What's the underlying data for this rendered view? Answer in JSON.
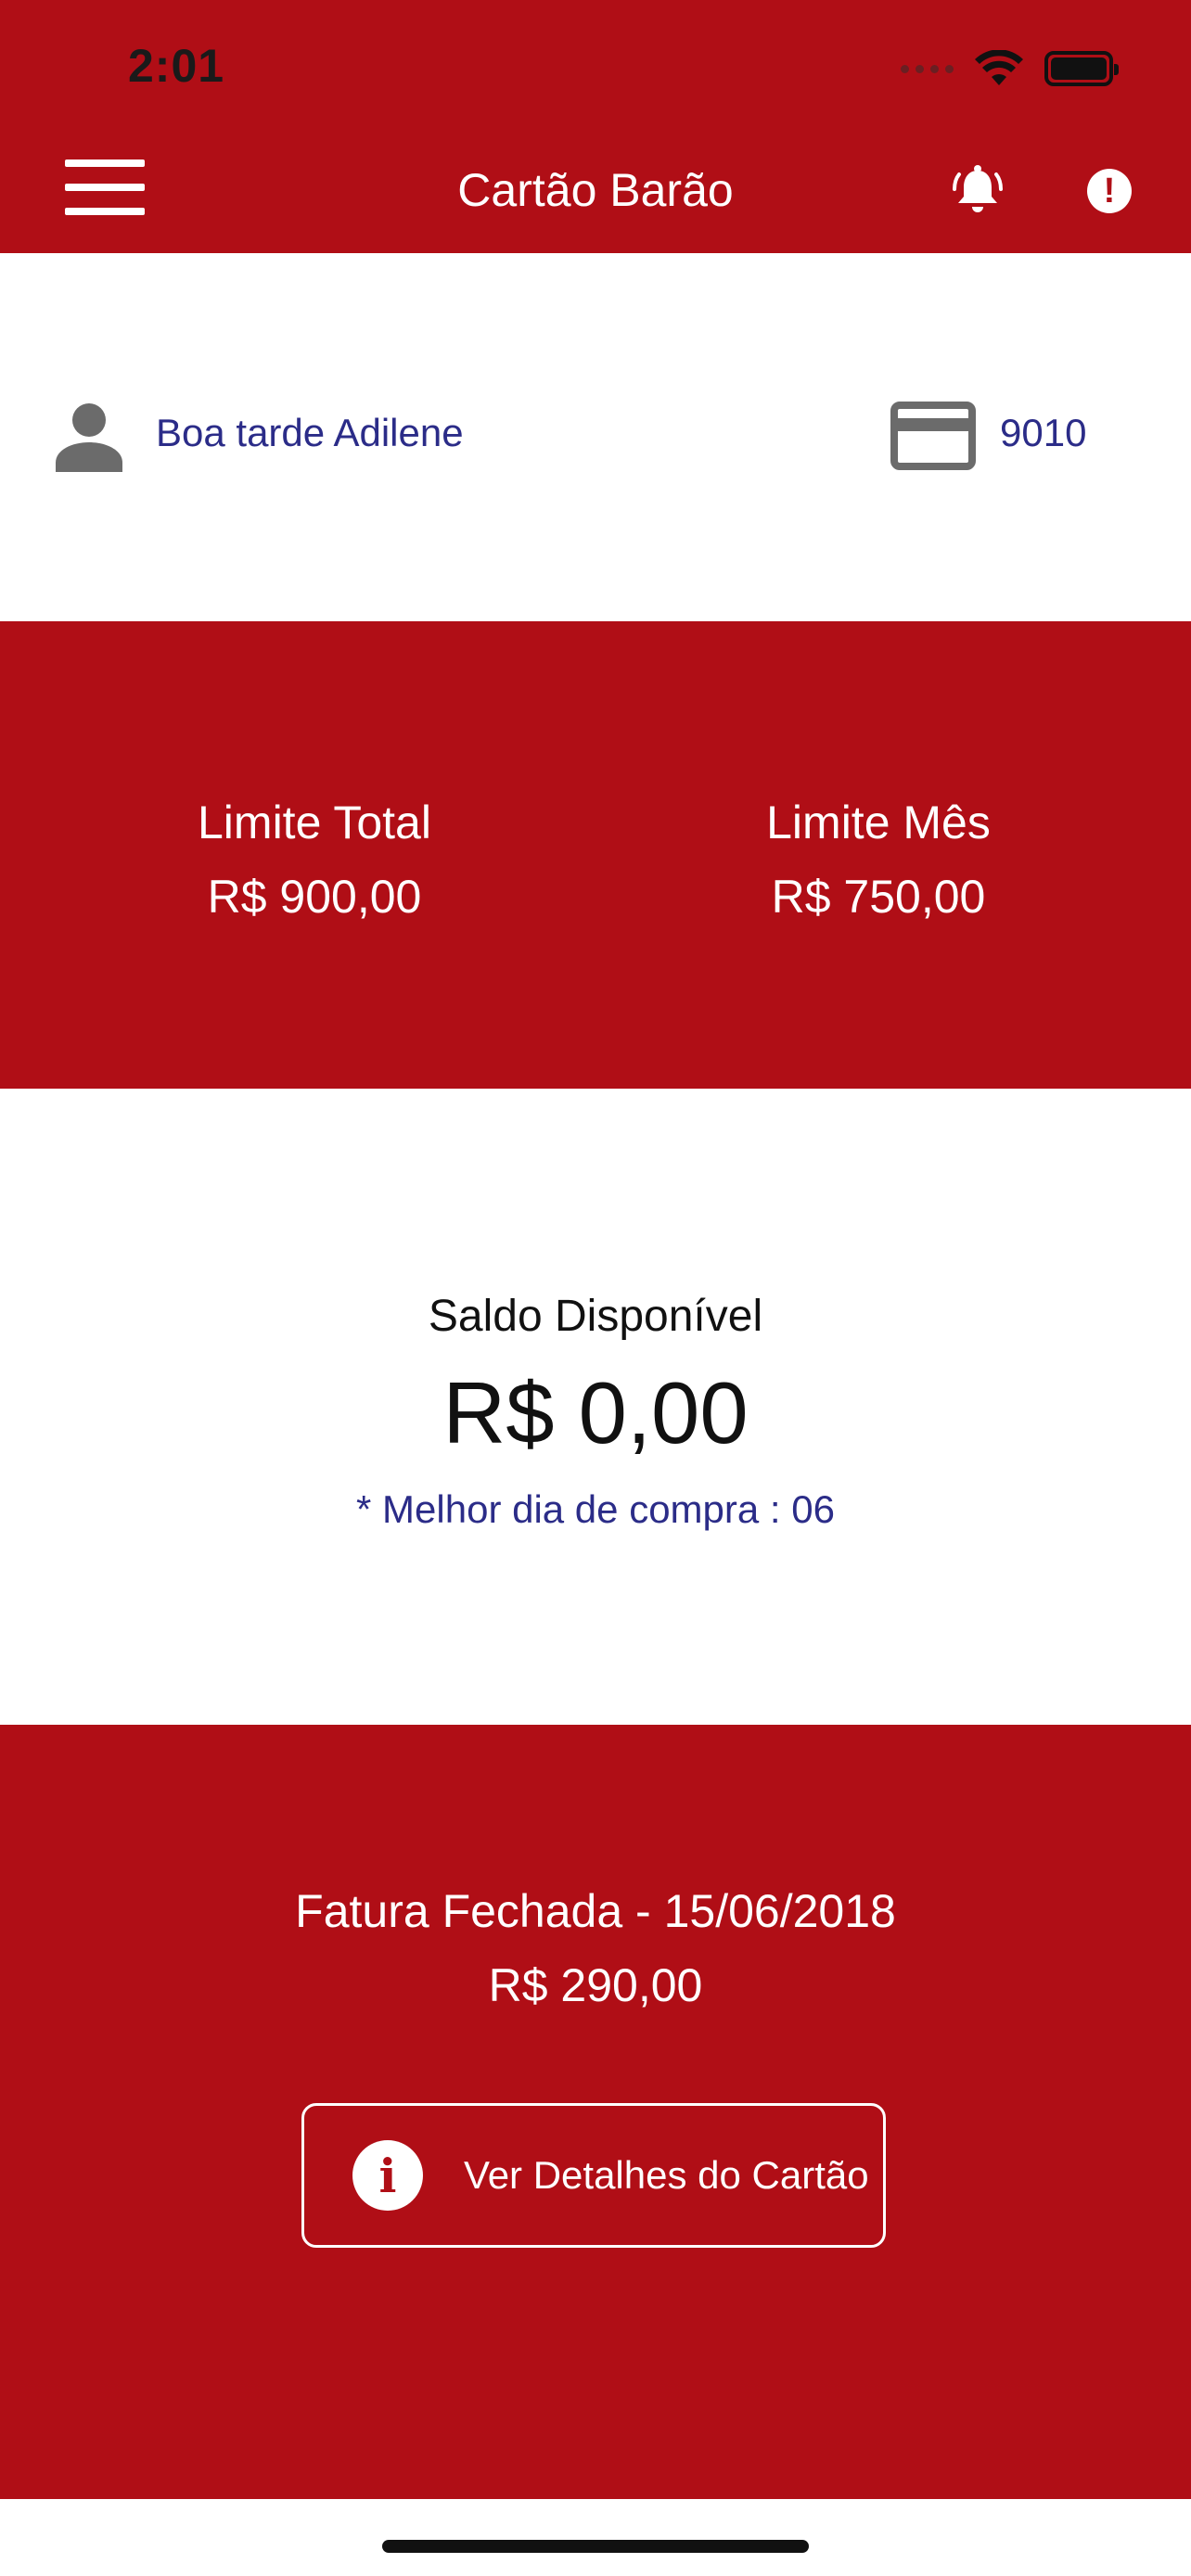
{
  "status_bar": {
    "time": "2:01"
  },
  "nav": {
    "title": "Cartão Barão"
  },
  "greeting": {
    "text": "Boa tarde Adilene",
    "card_number": "9010"
  },
  "limits": {
    "total_label": "Limite Total",
    "total_value": "R$ 900,00",
    "month_label": "Limite Mês",
    "month_value": "R$ 750,00"
  },
  "saldo": {
    "label": "Saldo Disponível",
    "value": "R$ 0,00",
    "note": "* Melhor dia de compra : 06"
  },
  "fatura": {
    "label": "Fatura Fechada - 15/06/2018",
    "value": "R$ 290,00",
    "details_button": "Ver Detalhes do Cartão"
  },
  "icons": {
    "menu": "hamburger-icon",
    "bell": "bell-ringing-icon",
    "alert": "exclamation-circle-icon",
    "person": "person-icon",
    "card": "credit-card-icon",
    "info": "info-icon"
  },
  "colors": {
    "brand_red": "#b00e16",
    "text_blue": "#2b2c88",
    "icon_gray": "#6b6b6b"
  }
}
